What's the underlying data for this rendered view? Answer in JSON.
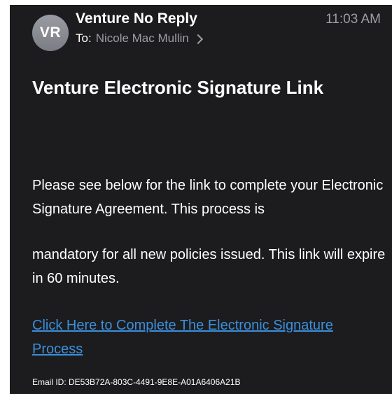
{
  "header": {
    "avatar_initials": "VR",
    "sender_name": "Venture No Reply",
    "time": "11:03 AM",
    "to_label": "To:",
    "recipient": "Nicole Mac Mullin"
  },
  "message": {
    "subject": "Venture Electronic Signature Link",
    "paragraph_1": "Please see below for the link to complete your Electronic Signature Agreement. This process is",
    "paragraph_2": "mandatory for all new policies issued. This link will expire in 60 minutes.",
    "link_text": "Click Here to Complete The Electronic Signature Process",
    "email_id": "Email ID: DE53B72A-803C-4491-9E8E-A01A6406A21B"
  },
  "colors": {
    "background": "#1c1c1e",
    "link": "#3b8fdc",
    "secondary_text": "#9d9da3"
  }
}
